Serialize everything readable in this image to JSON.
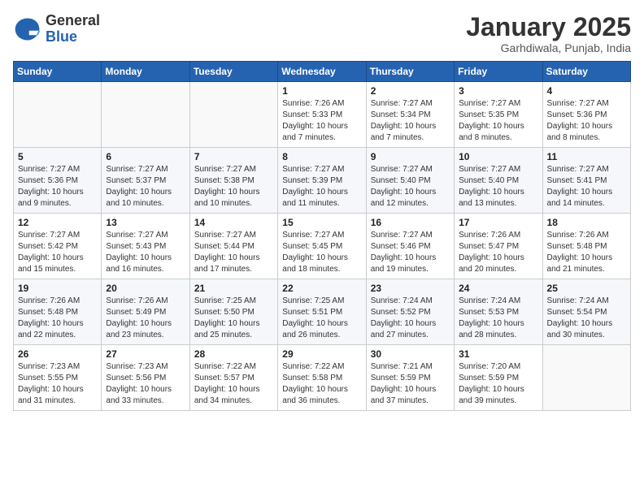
{
  "header": {
    "logo_general": "General",
    "logo_blue": "Blue",
    "month": "January 2025",
    "location": "Garhdiwala, Punjab, India"
  },
  "weekdays": [
    "Sunday",
    "Monday",
    "Tuesday",
    "Wednesday",
    "Thursday",
    "Friday",
    "Saturday"
  ],
  "weeks": [
    [
      {
        "day": "",
        "info": ""
      },
      {
        "day": "",
        "info": ""
      },
      {
        "day": "",
        "info": ""
      },
      {
        "day": "1",
        "info": "Sunrise: 7:26 AM\nSunset: 5:33 PM\nDaylight: 10 hours\nand 7 minutes."
      },
      {
        "day": "2",
        "info": "Sunrise: 7:27 AM\nSunset: 5:34 PM\nDaylight: 10 hours\nand 7 minutes."
      },
      {
        "day": "3",
        "info": "Sunrise: 7:27 AM\nSunset: 5:35 PM\nDaylight: 10 hours\nand 8 minutes."
      },
      {
        "day": "4",
        "info": "Sunrise: 7:27 AM\nSunset: 5:36 PM\nDaylight: 10 hours\nand 8 minutes."
      }
    ],
    [
      {
        "day": "5",
        "info": "Sunrise: 7:27 AM\nSunset: 5:36 PM\nDaylight: 10 hours\nand 9 minutes."
      },
      {
        "day": "6",
        "info": "Sunrise: 7:27 AM\nSunset: 5:37 PM\nDaylight: 10 hours\nand 10 minutes."
      },
      {
        "day": "7",
        "info": "Sunrise: 7:27 AM\nSunset: 5:38 PM\nDaylight: 10 hours\nand 10 minutes."
      },
      {
        "day": "8",
        "info": "Sunrise: 7:27 AM\nSunset: 5:39 PM\nDaylight: 10 hours\nand 11 minutes."
      },
      {
        "day": "9",
        "info": "Sunrise: 7:27 AM\nSunset: 5:40 PM\nDaylight: 10 hours\nand 12 minutes."
      },
      {
        "day": "10",
        "info": "Sunrise: 7:27 AM\nSunset: 5:40 PM\nDaylight: 10 hours\nand 13 minutes."
      },
      {
        "day": "11",
        "info": "Sunrise: 7:27 AM\nSunset: 5:41 PM\nDaylight: 10 hours\nand 14 minutes."
      }
    ],
    [
      {
        "day": "12",
        "info": "Sunrise: 7:27 AM\nSunset: 5:42 PM\nDaylight: 10 hours\nand 15 minutes."
      },
      {
        "day": "13",
        "info": "Sunrise: 7:27 AM\nSunset: 5:43 PM\nDaylight: 10 hours\nand 16 minutes."
      },
      {
        "day": "14",
        "info": "Sunrise: 7:27 AM\nSunset: 5:44 PM\nDaylight: 10 hours\nand 17 minutes."
      },
      {
        "day": "15",
        "info": "Sunrise: 7:27 AM\nSunset: 5:45 PM\nDaylight: 10 hours\nand 18 minutes."
      },
      {
        "day": "16",
        "info": "Sunrise: 7:27 AM\nSunset: 5:46 PM\nDaylight: 10 hours\nand 19 minutes."
      },
      {
        "day": "17",
        "info": "Sunrise: 7:26 AM\nSunset: 5:47 PM\nDaylight: 10 hours\nand 20 minutes."
      },
      {
        "day": "18",
        "info": "Sunrise: 7:26 AM\nSunset: 5:48 PM\nDaylight: 10 hours\nand 21 minutes."
      }
    ],
    [
      {
        "day": "19",
        "info": "Sunrise: 7:26 AM\nSunset: 5:48 PM\nDaylight: 10 hours\nand 22 minutes."
      },
      {
        "day": "20",
        "info": "Sunrise: 7:26 AM\nSunset: 5:49 PM\nDaylight: 10 hours\nand 23 minutes."
      },
      {
        "day": "21",
        "info": "Sunrise: 7:25 AM\nSunset: 5:50 PM\nDaylight: 10 hours\nand 25 minutes."
      },
      {
        "day": "22",
        "info": "Sunrise: 7:25 AM\nSunset: 5:51 PM\nDaylight: 10 hours\nand 26 minutes."
      },
      {
        "day": "23",
        "info": "Sunrise: 7:24 AM\nSunset: 5:52 PM\nDaylight: 10 hours\nand 27 minutes."
      },
      {
        "day": "24",
        "info": "Sunrise: 7:24 AM\nSunset: 5:53 PM\nDaylight: 10 hours\nand 28 minutes."
      },
      {
        "day": "25",
        "info": "Sunrise: 7:24 AM\nSunset: 5:54 PM\nDaylight: 10 hours\nand 30 minutes."
      }
    ],
    [
      {
        "day": "26",
        "info": "Sunrise: 7:23 AM\nSunset: 5:55 PM\nDaylight: 10 hours\nand 31 minutes."
      },
      {
        "day": "27",
        "info": "Sunrise: 7:23 AM\nSunset: 5:56 PM\nDaylight: 10 hours\nand 33 minutes."
      },
      {
        "day": "28",
        "info": "Sunrise: 7:22 AM\nSunset: 5:57 PM\nDaylight: 10 hours\nand 34 minutes."
      },
      {
        "day": "29",
        "info": "Sunrise: 7:22 AM\nSunset: 5:58 PM\nDaylight: 10 hours\nand 36 minutes."
      },
      {
        "day": "30",
        "info": "Sunrise: 7:21 AM\nSunset: 5:59 PM\nDaylight: 10 hours\nand 37 minutes."
      },
      {
        "day": "31",
        "info": "Sunrise: 7:20 AM\nSunset: 5:59 PM\nDaylight: 10 hours\nand 39 minutes."
      },
      {
        "day": "",
        "info": ""
      }
    ]
  ]
}
